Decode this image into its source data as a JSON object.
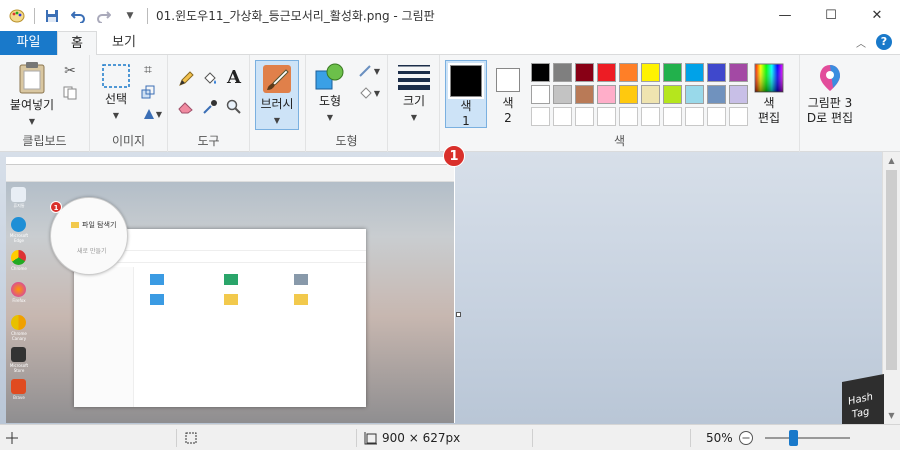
{
  "window": {
    "title": "01.윈도우11_가상화_등근모서리_활성화.png - 그림판",
    "controls": [
      "minimize",
      "maximize",
      "close"
    ]
  },
  "tabs": {
    "file": "파일",
    "home": "홈",
    "view": "보기"
  },
  "ribbon": {
    "clipboard": {
      "paste": "붙여넣기",
      "label": "클립보드"
    },
    "image": {
      "select": "선택",
      "label": "이미지"
    },
    "tools": {
      "label": "도구"
    },
    "brush": {
      "label": "브러시"
    },
    "shapes": {
      "shape": "도형",
      "label": "도형"
    },
    "size": {
      "label": "크기"
    },
    "colors": {
      "color1_line1": "색",
      "color1_line2": "1",
      "color2_line1": "색",
      "color2_line2": "2",
      "edit_line1": "색",
      "edit_line2": "편집",
      "label": "색",
      "color1": "#000000",
      "color2": "#ffffff",
      "palette_row1": [
        "#000000",
        "#7f7f7f",
        "#880015",
        "#ed1c24",
        "#ff7f27",
        "#fff200",
        "#22b14c",
        "#00a2e8",
        "#3f48cc",
        "#a349a4"
      ],
      "palette_row2": [
        "#ffffff",
        "#c3c3c3",
        "#b97a57",
        "#ffaec9",
        "#ffc90e",
        "#efe4b0",
        "#b5e61d",
        "#99d9ea",
        "#7092be",
        "#c8bfe7"
      ]
    },
    "paint3d": {
      "line1": "그림판 3",
      "line2": "D로 편집"
    }
  },
  "canvas": {
    "marker_main": "1",
    "marker_small": "1",
    "explorer_title": "파일 탐색기",
    "explorer_new": "새로 만들기",
    "desktop_icons": [
      "휴지통",
      "Microsoft Edge",
      "Chrome",
      "Firefox",
      "Chrome Canary",
      "Microsoft Store",
      "Brave"
    ]
  },
  "status": {
    "dimensions": "900 × 627px",
    "zoom": "50%",
    "zoom_fraction": 0.5
  },
  "watermark": {
    "line1": "Hash",
    "line2": "Tag"
  }
}
